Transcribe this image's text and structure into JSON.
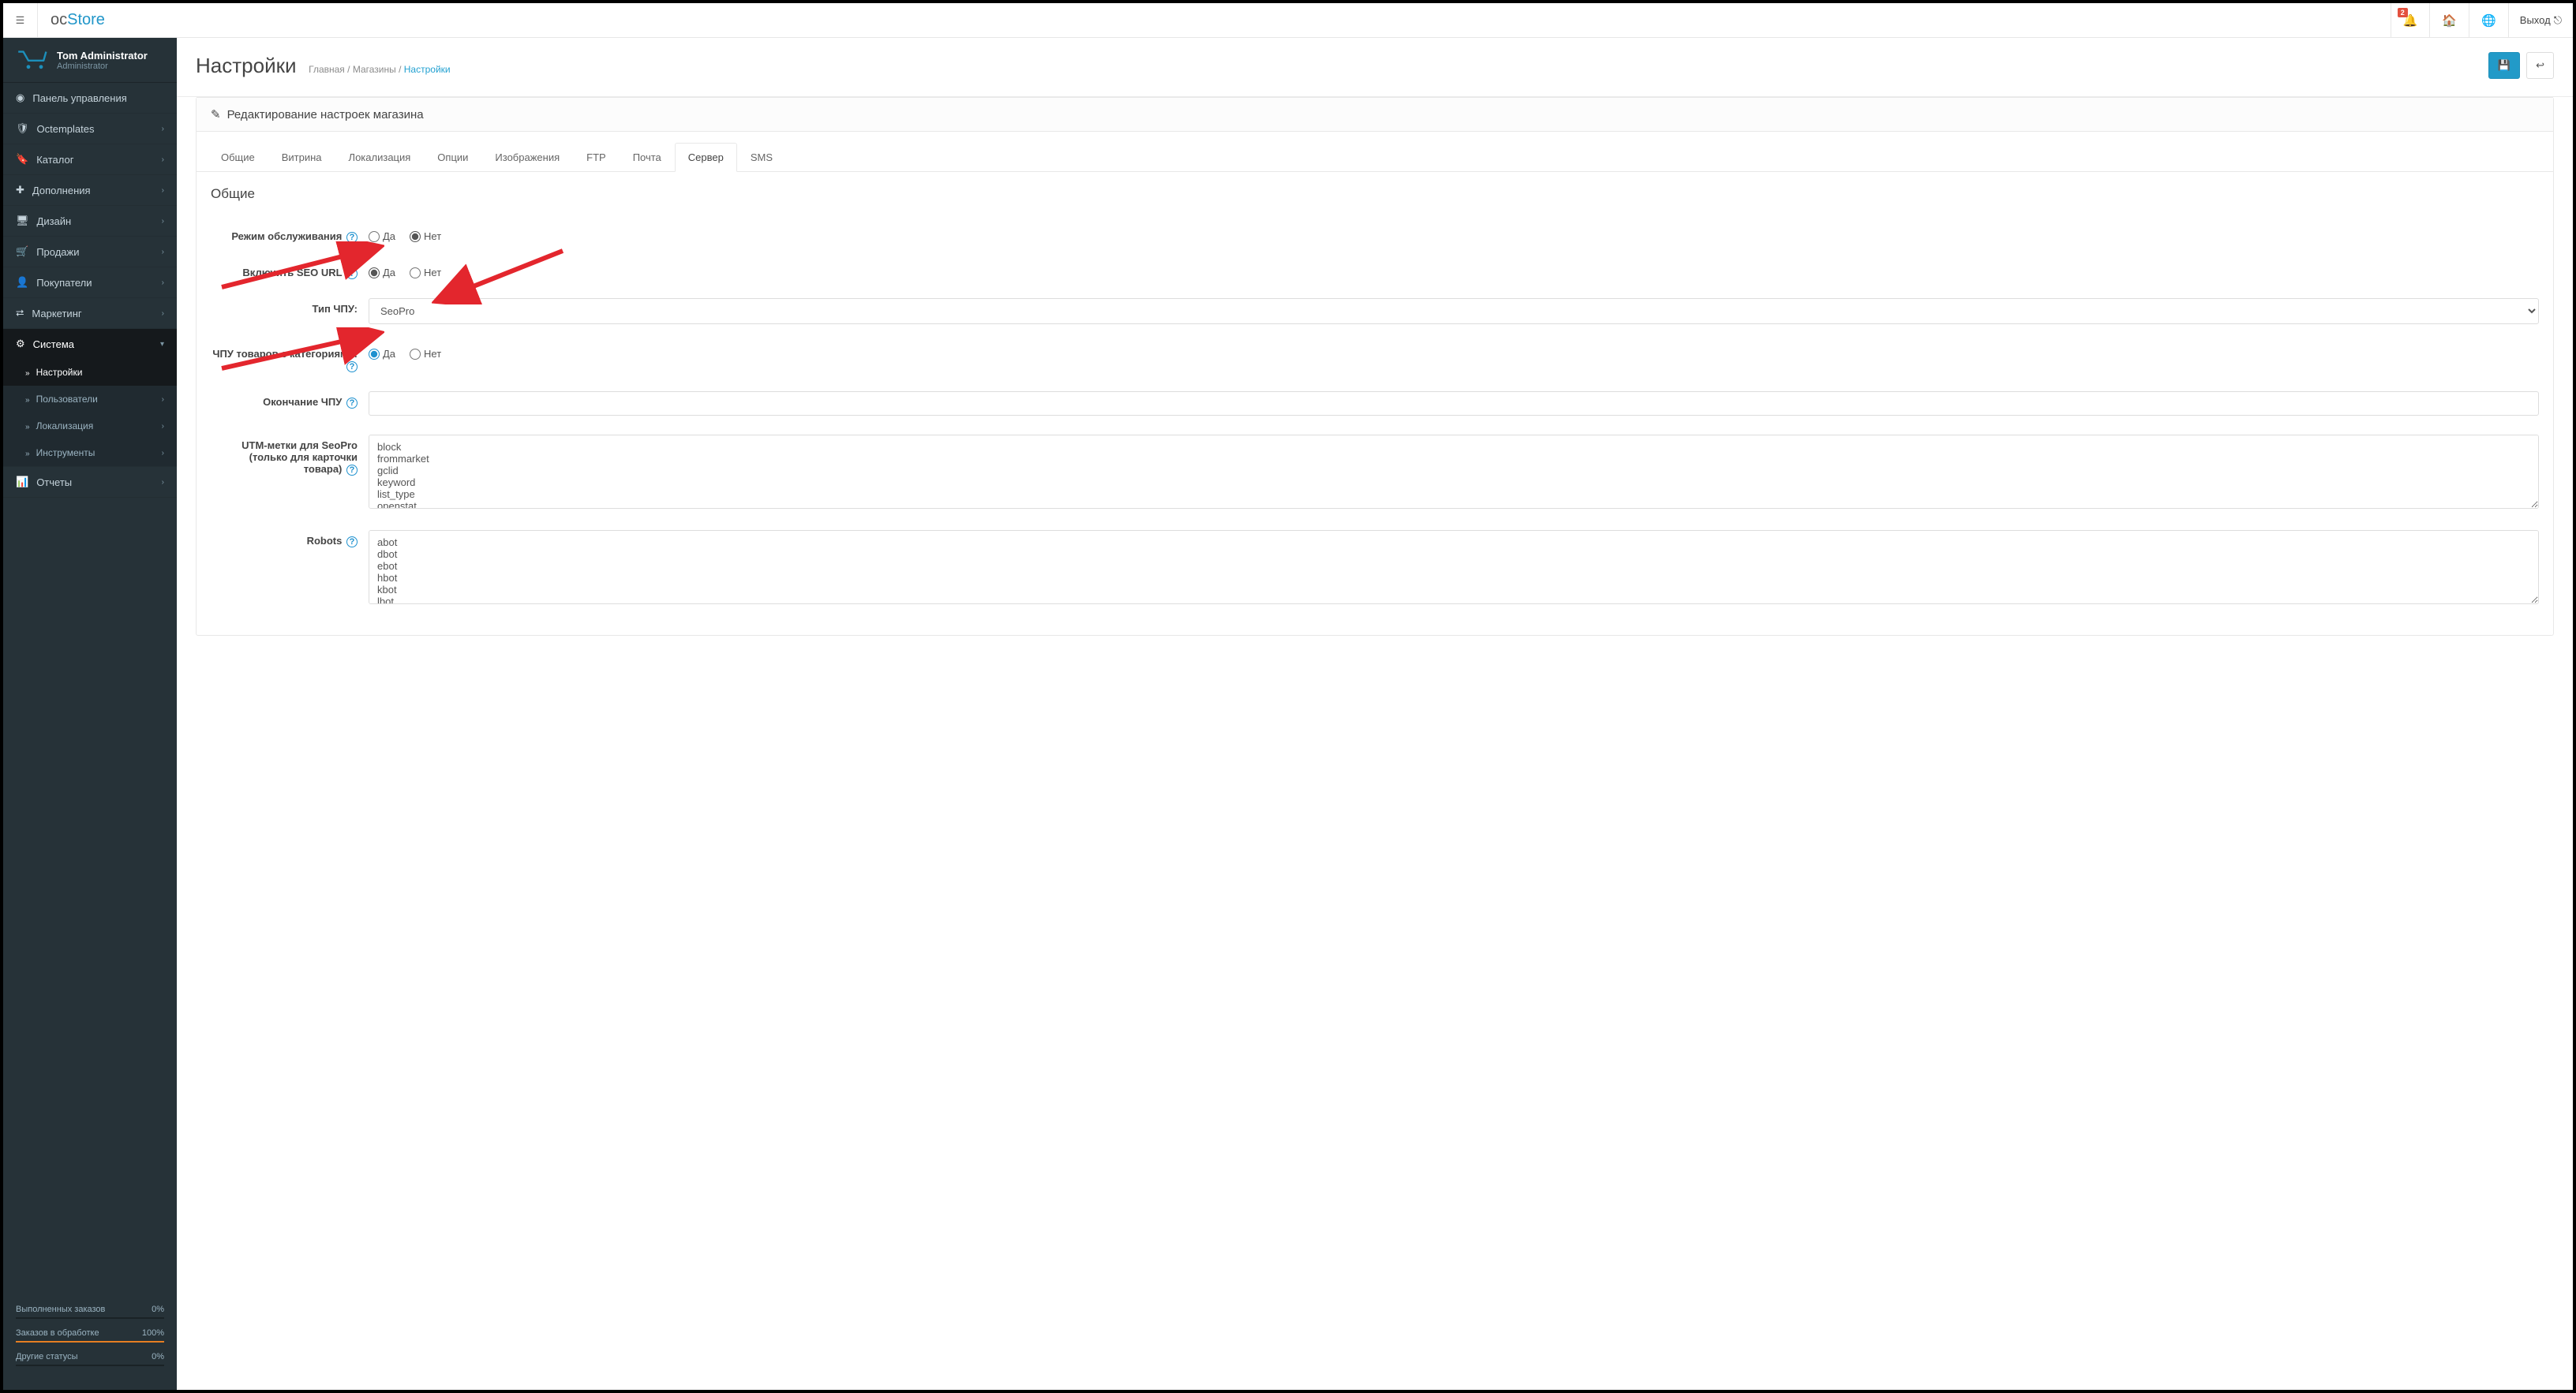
{
  "brand": {
    "oc": "oc",
    "store": "Store"
  },
  "header": {
    "notif_badge": "2",
    "logout": "Выход"
  },
  "profile": {
    "name": "Tom Administrator",
    "role": "Administrator"
  },
  "sidebar": {
    "items": [
      {
        "label": "Панель управления",
        "expandable": false
      },
      {
        "label": "Octemplates",
        "expandable": true
      },
      {
        "label": "Каталог",
        "expandable": true
      },
      {
        "label": "Дополнения",
        "expandable": true
      },
      {
        "label": "Дизайн",
        "expandable": true
      },
      {
        "label": "Продажи",
        "expandable": true
      },
      {
        "label": "Покупатели",
        "expandable": true
      },
      {
        "label": "Маркетинг",
        "expandable": true
      },
      {
        "label": "Система",
        "expandable": true,
        "active": true
      },
      {
        "label": "Отчеты",
        "expandable": true
      }
    ],
    "subitems": [
      {
        "label": "Настройки",
        "selected": true
      },
      {
        "label": "Пользователи",
        "chev": true
      },
      {
        "label": "Локализация",
        "chev": true
      },
      {
        "label": "Инструменты",
        "chev": true
      }
    ]
  },
  "stats": [
    {
      "label": "Выполненных заказов",
      "value": "0%",
      "color": "teal"
    },
    {
      "label": "Заказов в обработке",
      "value": "100%",
      "color": "orange"
    },
    {
      "label": "Другие статусы",
      "value": "0%",
      "color": "blue"
    }
  ],
  "page": {
    "title": "Настройки",
    "crumb_home": "Главная",
    "crumb_stores": "Магазины",
    "crumb_settings": "Настройки"
  },
  "panel": {
    "title": "Редактирование настроек магазина",
    "section": "Общие"
  },
  "tabs": [
    "Общие",
    "Витрина",
    "Локализация",
    "Опции",
    "Изображения",
    "FTP",
    "Почта",
    "Сервер",
    "SMS"
  ],
  "active_tab": "Сервер",
  "form": {
    "maintenance_label": "Режим обслуживания",
    "yes": "Да",
    "no": "Нет",
    "maintenance": "no",
    "seo_label": "Включить SEO URL",
    "seo": "yes",
    "chpu_type_label": "Тип ЧПУ:",
    "chpu_type": "SeoPro",
    "chpu_type_options": [
      "SeoPro"
    ],
    "chpu_cat_label": "ЧПУ товаров с категориями:",
    "chpu_cat": "yes",
    "chpu_end_label": "Окончание ЧПУ",
    "chpu_end": "",
    "utm_label": "UTM-метки для SeoPro (только для карточки товара)",
    "utm_value": "block\nfrommarket\ngclid\nkeyword\nlist_type\nopenstat",
    "robots_label": "Robots",
    "robots_value": "abot\ndbot\nebot\nhbot\nkbot\nlbot"
  }
}
